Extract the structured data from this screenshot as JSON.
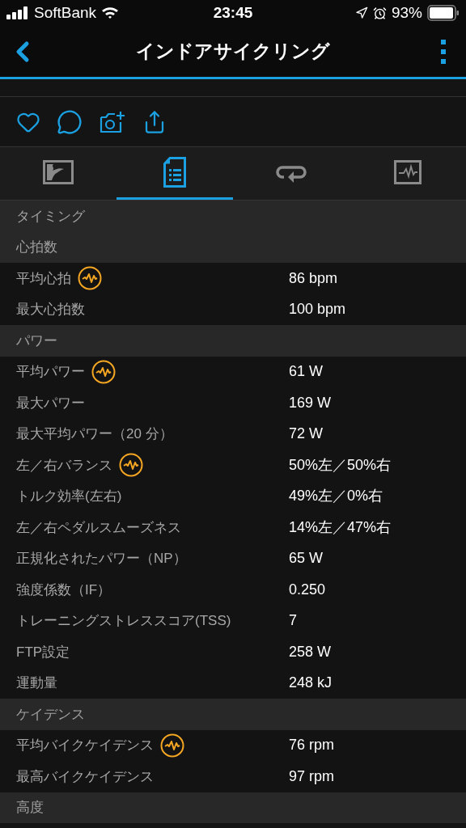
{
  "status_bar": {
    "carrier": "SoftBank",
    "time": "23:45",
    "battery": "93%"
  },
  "nav": {
    "title": "インドアサイクリング"
  },
  "tabs": [
    {
      "kind": "map",
      "selected": false
    },
    {
      "kind": "details",
      "selected": true
    },
    {
      "kind": "laps",
      "selected": false
    },
    {
      "kind": "charts",
      "selected": false
    }
  ],
  "sections": [
    {
      "title": "タイミング"
    },
    {
      "title": "心拍数",
      "rows": [
        {
          "label": "平均心拍",
          "value": "86 bpm",
          "chart_icon": true
        },
        {
          "label": "最大心拍数",
          "value": "100 bpm",
          "chart_icon": false
        }
      ]
    },
    {
      "title": "パワー",
      "rows": [
        {
          "label": "平均パワー",
          "value": "61 W",
          "chart_icon": true
        },
        {
          "label": "最大パワー",
          "value": "169 W",
          "chart_icon": false
        },
        {
          "label": "最大平均パワー（20 分）",
          "value": "72 W",
          "chart_icon": false
        },
        {
          "label": "左／右バランス",
          "value": "50%左／50%右",
          "chart_icon": true
        },
        {
          "label": "トルク効率(左右)",
          "value": "49%左／0%右",
          "chart_icon": false
        },
        {
          "label": "左／右ペダルスムーズネス",
          "value": "14%左／47%右",
          "chart_icon": false
        },
        {
          "label": "正規化されたパワー（NP）",
          "value": "65 W",
          "chart_icon": false
        },
        {
          "label": "強度係数（IF）",
          "value": "0.250",
          "chart_icon": false
        },
        {
          "label": "トレーニングストレススコア(TSS)",
          "value": "7",
          "chart_icon": false
        },
        {
          "label": "FTP設定",
          "value": "258 W",
          "chart_icon": false
        },
        {
          "label": "運動量",
          "value": "248 kJ",
          "chart_icon": false
        }
      ]
    },
    {
      "title": "ケイデンス",
      "rows": [
        {
          "label": "平均バイクケイデンス",
          "value": "76 rpm",
          "chart_icon": true
        },
        {
          "label": "最高バイクケイデンス",
          "value": "97 rpm",
          "chart_icon": false
        }
      ]
    },
    {
      "title": "高度"
    }
  ]
}
